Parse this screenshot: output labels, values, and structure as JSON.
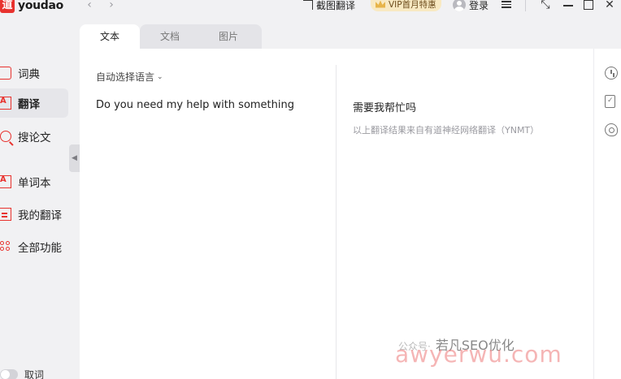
{
  "app": {
    "logo_mark": "道",
    "logo_text": "youdao"
  },
  "titlebar": {
    "screenshot_translate": "截图翻译",
    "vip_badge": "VIP首月特惠",
    "login": "登录"
  },
  "sidebar": {
    "items": [
      {
        "label": "词典"
      },
      {
        "label": "翻译"
      },
      {
        "label": "搜论文"
      },
      {
        "label": "单词本"
      },
      {
        "label": "我的翻译"
      },
      {
        "label": "全部功能"
      }
    ],
    "cancel_label": "取词"
  },
  "tabs": [
    {
      "label": "文本"
    },
    {
      "label": "文档"
    },
    {
      "label": "图片"
    }
  ],
  "translate": {
    "language_select": "自动选择语言",
    "source_text": "Do you need my help with something",
    "result_text": "需要我帮忙吗",
    "result_note": "以上翻译结果来自有道神经网络翻译（YNMT）"
  },
  "watermark": {
    "channel": "公众号·",
    "name": "若凡SEO优化",
    "site": "awyerwu.com"
  },
  "colors": {
    "accent": "#e8322e",
    "background": "#f1f1f3",
    "panel": "#ffffff",
    "vip_bg": "#f8e9c2"
  }
}
